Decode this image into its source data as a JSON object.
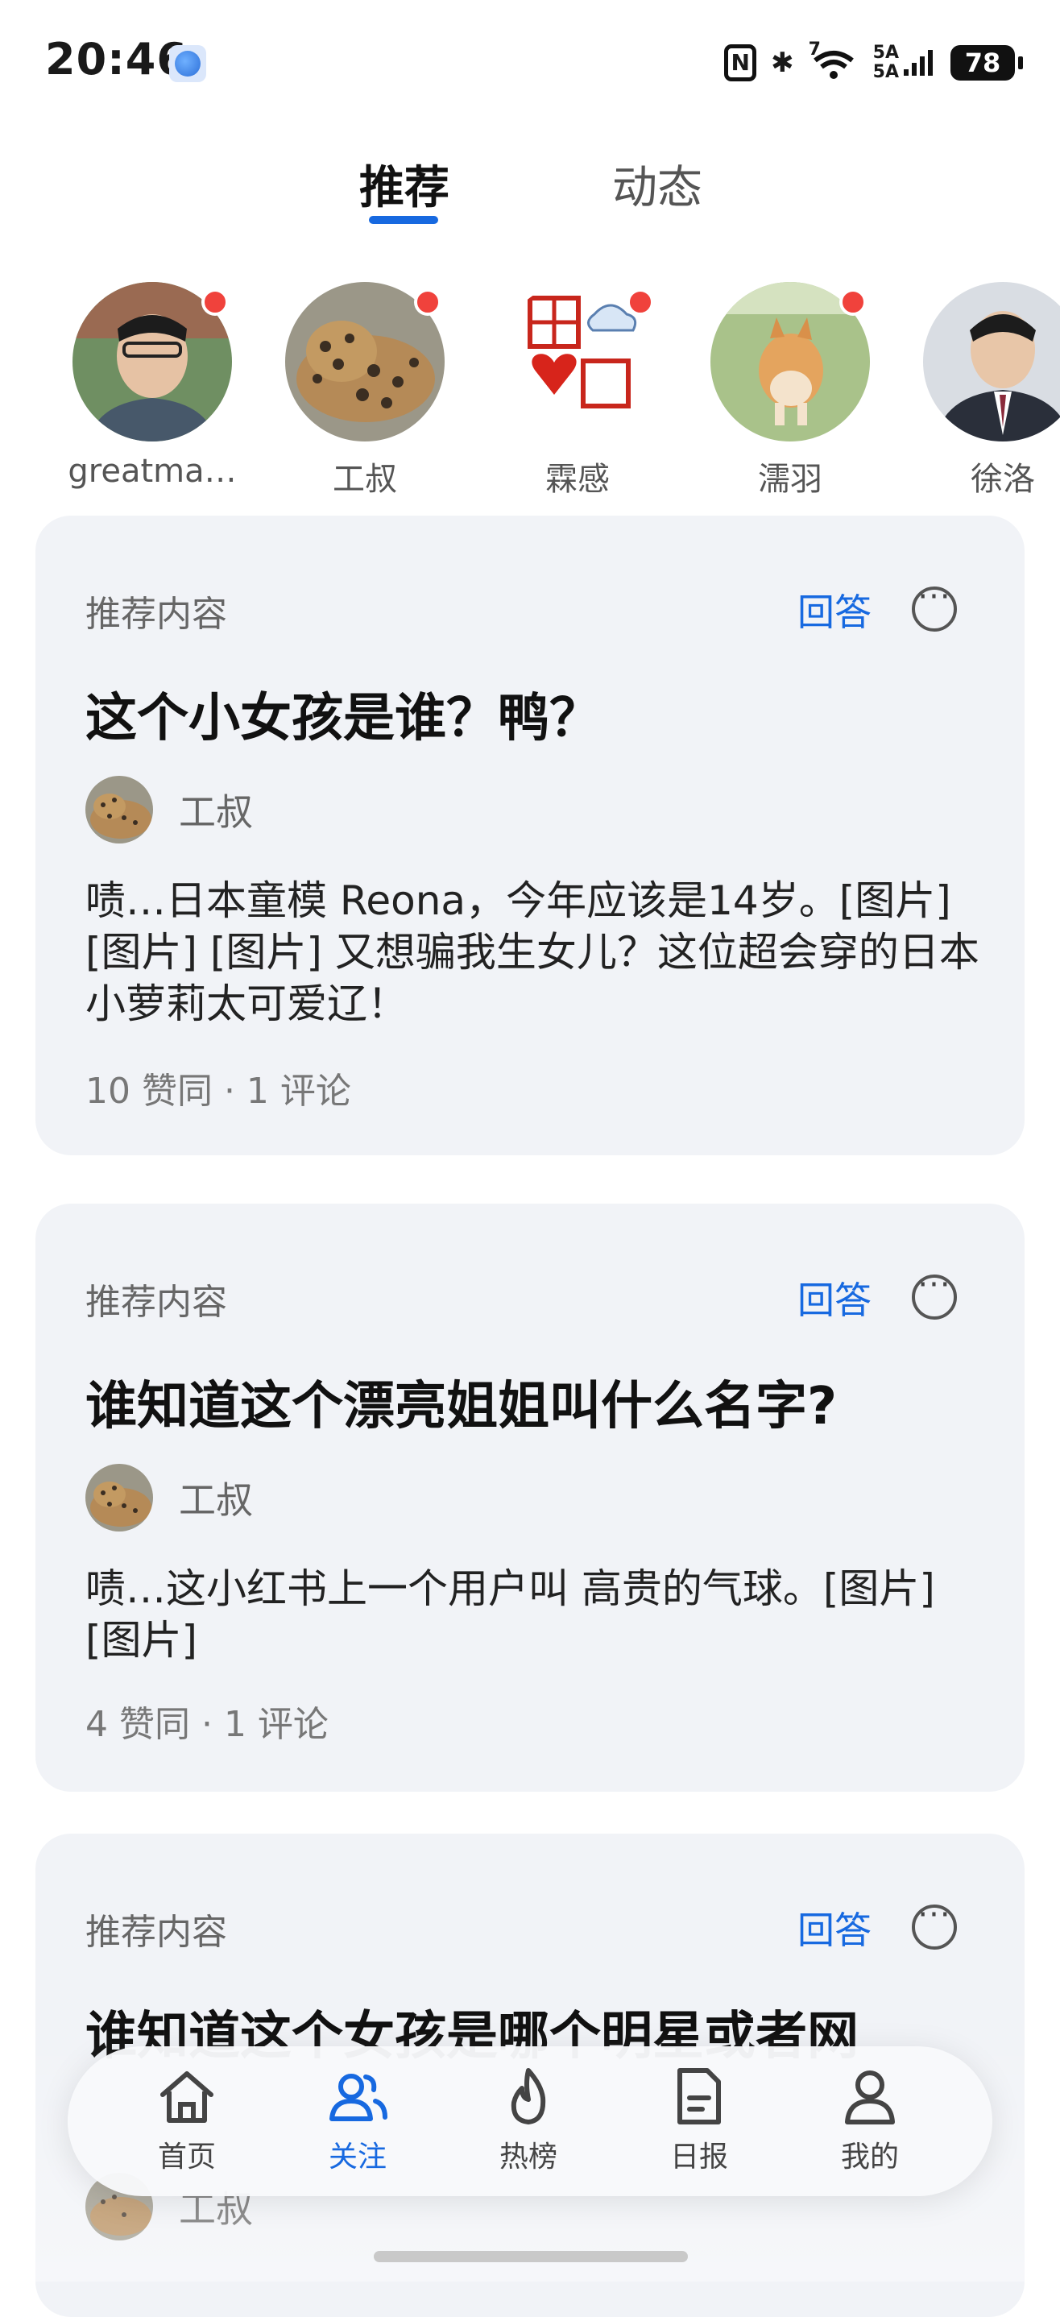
{
  "status_bar": {
    "time": "20:46",
    "nfc": "N",
    "bluetooth": "✱",
    "wifi_tag": "7",
    "signal_label": "5A\n5A",
    "battery": "78"
  },
  "tabs": [
    {
      "label": "推荐",
      "active": true
    },
    {
      "label": "动态",
      "active": false
    }
  ],
  "following": [
    {
      "name": "greatma…",
      "has_update": true
    },
    {
      "name": "工叔",
      "has_update": true
    },
    {
      "name": "霖感",
      "has_update": true
    },
    {
      "name": "濡羽",
      "has_update": true
    },
    {
      "name": "徐洛",
      "has_update": false
    }
  ],
  "cards": [
    {
      "tag": "推荐内容",
      "answer_label": "回答",
      "title": "这个小女孩是谁？鸭？",
      "author": "工叔",
      "body": "啧…日本童模 Reona，今年应该是14岁。[图片] [图片] [图片] 又想骗我生女儿？这位超会穿的日本小萝莉太可爱辽！",
      "stats": "10 赞同 · 1 评论"
    },
    {
      "tag": "推荐内容",
      "answer_label": "回答",
      "title": "谁知道这个漂亮姐姐叫什么名字?",
      "author": "工叔",
      "body": "啧…这小红书上一个用户叫 高贵的气球。[图片] [图片]",
      "stats": "4 赞同 · 1 评论"
    },
    {
      "tag": "推荐内容",
      "answer_label": "回答",
      "title": "谁知道这个女孩是哪个明星或者网",
      "author": "工叔"
    }
  ],
  "bottom_nav": [
    {
      "label": "首页",
      "icon": "home-icon",
      "active": false
    },
    {
      "label": "关注",
      "icon": "people-icon",
      "active": true
    },
    {
      "label": "热榜",
      "icon": "flame-icon",
      "active": false
    },
    {
      "label": "日报",
      "icon": "document-icon",
      "active": false
    },
    {
      "label": "我的",
      "icon": "person-icon",
      "active": false
    }
  ],
  "colors": {
    "accent": "#1769e0",
    "badge": "#f0423c",
    "card_bg": "#f1f3f7"
  }
}
